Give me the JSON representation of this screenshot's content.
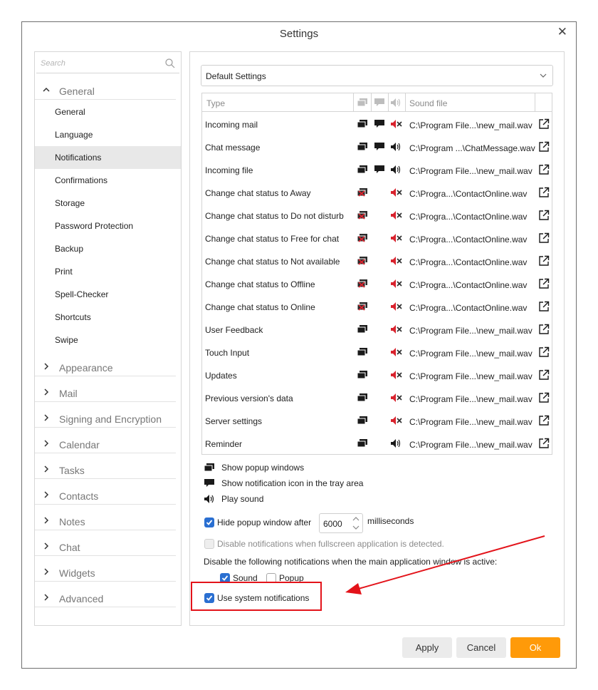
{
  "window": {
    "title": "Settings"
  },
  "sidebar": {
    "search_placeholder": "Search",
    "general_label": "General",
    "sub_items": [
      "General",
      "Language",
      "Notifications",
      "Confirmations",
      "Storage",
      "Password Protection",
      "Backup",
      "Print",
      "Spell-Checker",
      "Shortcuts",
      "Swipe"
    ],
    "active_item": "Notifications",
    "categories": [
      "Appearance",
      "Mail",
      "Signing and Encryption",
      "Calendar",
      "Tasks",
      "Contacts",
      "Notes",
      "Chat",
      "Widgets",
      "Advanced"
    ]
  },
  "profile_select": {
    "value": "Default Settings"
  },
  "table": {
    "header": {
      "type": "Type",
      "sound_file": "Sound file"
    },
    "rows": [
      {
        "type": "Incoming mail",
        "popup": "on",
        "tray": true,
        "sound": "off",
        "file": "C:\\Program File...\\new_mail.wav"
      },
      {
        "type": "Chat message",
        "popup": "on",
        "tray": true,
        "sound": "on",
        "file": "C:\\Program ...\\ChatMessage.wav"
      },
      {
        "type": "Incoming file",
        "popup": "on",
        "tray": true,
        "sound": "on",
        "file": "C:\\Program File...\\new_mail.wav"
      },
      {
        "type": "Change chat status to Away",
        "popup": "off",
        "tray": false,
        "sound": "off",
        "file": "C:\\Progra...\\ContactOnline.wav"
      },
      {
        "type": "Change chat status to Do not disturb",
        "popup": "off",
        "tray": false,
        "sound": "off",
        "file": "C:\\Progra...\\ContactOnline.wav"
      },
      {
        "type": "Change chat status to Free for chat",
        "popup": "off",
        "tray": false,
        "sound": "off",
        "file": "C:\\Progra...\\ContactOnline.wav"
      },
      {
        "type": "Change chat status to Not available",
        "popup": "off",
        "tray": false,
        "sound": "off",
        "file": "C:\\Progra...\\ContactOnline.wav"
      },
      {
        "type": "Change chat status to Offline",
        "popup": "off",
        "tray": false,
        "sound": "off",
        "file": "C:\\Progra...\\ContactOnline.wav"
      },
      {
        "type": "Change chat status to Online",
        "popup": "off",
        "tray": false,
        "sound": "off",
        "file": "C:\\Progra...\\ContactOnline.wav"
      },
      {
        "type": "User Feedback",
        "popup": "on",
        "tray": false,
        "sound": "off",
        "file": "C:\\Program File...\\new_mail.wav"
      },
      {
        "type": "Touch Input",
        "popup": "on",
        "tray": false,
        "sound": "off",
        "file": "C:\\Program File...\\new_mail.wav"
      },
      {
        "type": "Updates",
        "popup": "on",
        "tray": false,
        "sound": "off",
        "file": "C:\\Program File...\\new_mail.wav"
      },
      {
        "type": "Previous version's data",
        "popup": "on",
        "tray": false,
        "sound": "off",
        "file": "C:\\Program File...\\new_mail.wav"
      },
      {
        "type": "Server settings",
        "popup": "on",
        "tray": false,
        "sound": "off",
        "file": "C:\\Program File...\\new_mail.wav"
      },
      {
        "type": "Reminder",
        "popup": "on",
        "tray": false,
        "sound": "on",
        "file": "C:\\Program File...\\new_mail.wav"
      }
    ]
  },
  "legend": {
    "popup": "Show popup windows",
    "tray": "Show notification icon in the tray area",
    "sound": "Play sound"
  },
  "options": {
    "hide_popup_label": "Hide popup window after",
    "hide_popup_checked": true,
    "hide_popup_value": "6000",
    "hide_popup_unit": "milliseconds",
    "disable_fullscreen_label": "Disable notifications when fullscreen application is detected.",
    "disable_when_active_label": "Disable the following notifications when the main application window is active:",
    "sound_label": "Sound",
    "sound_checked": true,
    "popup_label": "Popup",
    "popup_checked": false,
    "system_notifications_label": "Use system notifications",
    "system_notifications_checked": true
  },
  "buttons": {
    "apply": "Apply",
    "cancel": "Cancel",
    "ok": "Ok"
  },
  "colors": {
    "accent": "#ff9a09",
    "checkbox": "#2a6fd1",
    "annotation": "#e3131a",
    "disabled_icon": "#d9232e"
  },
  "icons": {
    "popup_on": "popup-window-icon",
    "popup_off": "popup-disabled-icon",
    "tray": "tray-bubble-icon",
    "sound_on": "speaker-icon",
    "sound_off": "speaker-muted-icon",
    "open": "open-external-icon"
  }
}
